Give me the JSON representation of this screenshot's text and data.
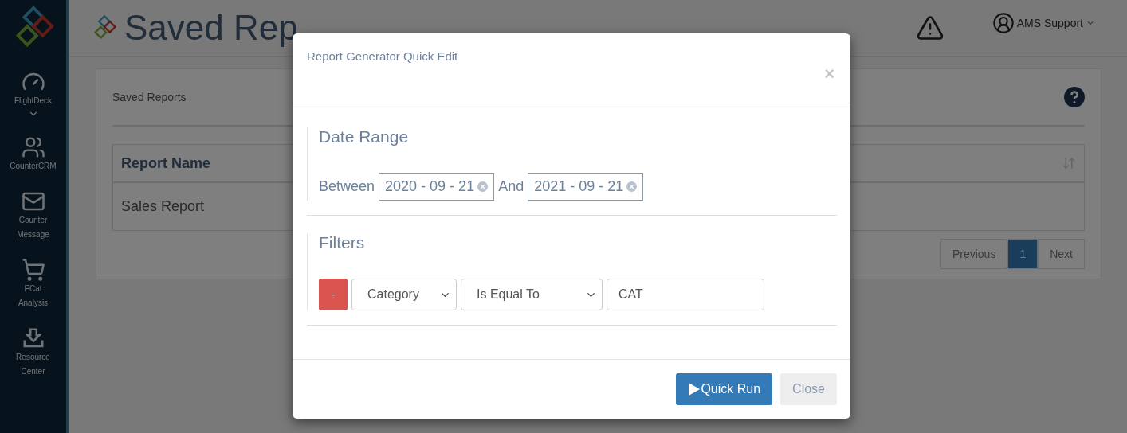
{
  "sidebar": {
    "items": [
      {
        "label": "FlightDeck",
        "has_submenu": true
      },
      {
        "label": "CounterCRM",
        "has_submenu": false
      },
      {
        "label": "Counter Message",
        "has_submenu": false
      },
      {
        "label": "ECat Analysis",
        "has_submenu": false
      },
      {
        "label": "Resource Center",
        "has_submenu": false
      }
    ]
  },
  "header": {
    "title": "Saved Rep",
    "user": "AMS Support"
  },
  "panel": {
    "heading": "Saved Reports",
    "table": {
      "columns": [
        "Report Name"
      ],
      "rows": [
        [
          "Sales Report"
        ]
      ]
    },
    "pagination": {
      "previous": "Previous",
      "pages": [
        {
          "label": "1",
          "selected": true
        }
      ],
      "next": "Next"
    }
  },
  "modal": {
    "title": "Report Generator Quick Edit",
    "close": "×",
    "date_range": {
      "heading": "Date Range",
      "between_label": "Between",
      "start": "2020 - 09 - 21",
      "and_label": "And",
      "end": "2021 - 09 - 21"
    },
    "filters": {
      "heading": "Filters",
      "rows": [
        {
          "remove": "-",
          "field": "Category",
          "operator": "Is Equal To",
          "value": "CAT"
        }
      ]
    },
    "buttons": [
      {
        "label": "Quick Run",
        "kind": "primary"
      },
      {
        "label": "Close",
        "kind": "default"
      }
    ]
  }
}
